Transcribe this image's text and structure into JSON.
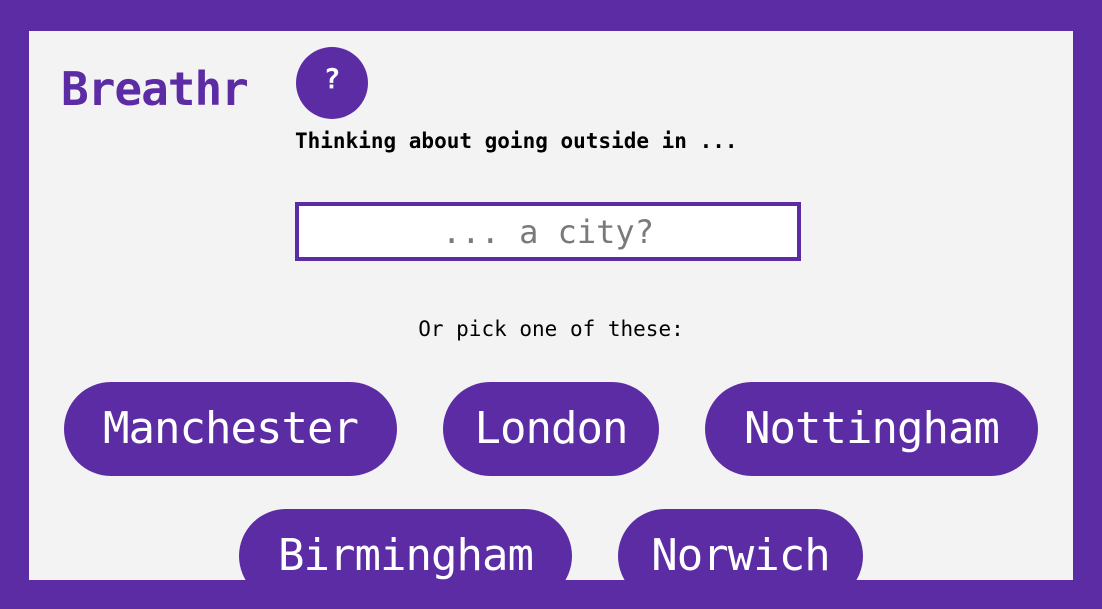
{
  "app": {
    "logo": "Breathr",
    "help_label": "?"
  },
  "search": {
    "prompt": "Thinking about going outside in ...",
    "placeholder": "... a city?",
    "value": ""
  },
  "suggestions": {
    "label": "Or pick one of these:",
    "cities": [
      "Manchester",
      "London",
      "Nottingham",
      "Birmingham",
      "Norwich"
    ]
  },
  "colors": {
    "brand": "#5c2ca4",
    "background": "#f3f3f3",
    "button_text": "#ffffff"
  }
}
